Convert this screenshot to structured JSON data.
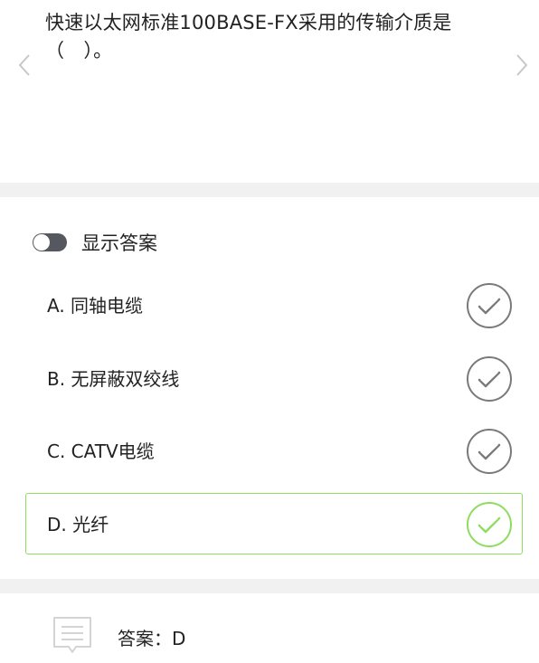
{
  "question": {
    "text": "快速以太网标准100BASE-FX采用的传输介质是（　）。"
  },
  "controls": {
    "show_answer_label": "显示答案",
    "show_answer_on": false
  },
  "options": [
    {
      "label": "A. 同轴电缆",
      "correct": false
    },
    {
      "label": "B. 无屏蔽双绞线",
      "correct": false
    },
    {
      "label": "C. CATV电缆",
      "correct": false
    },
    {
      "label": "D. 光纤",
      "correct": true
    }
  ],
  "answer": {
    "text": "答案：D"
  },
  "icons": {
    "prev": "chevron-left-icon",
    "next": "chevron-right-icon",
    "check": "check-circle-icon",
    "answer": "message-icon"
  },
  "colors": {
    "correct": "#8fdc5e",
    "neutral_check": "#7a7a7a",
    "toggle_off": "#55585e",
    "divider": "#f1f1f1"
  }
}
